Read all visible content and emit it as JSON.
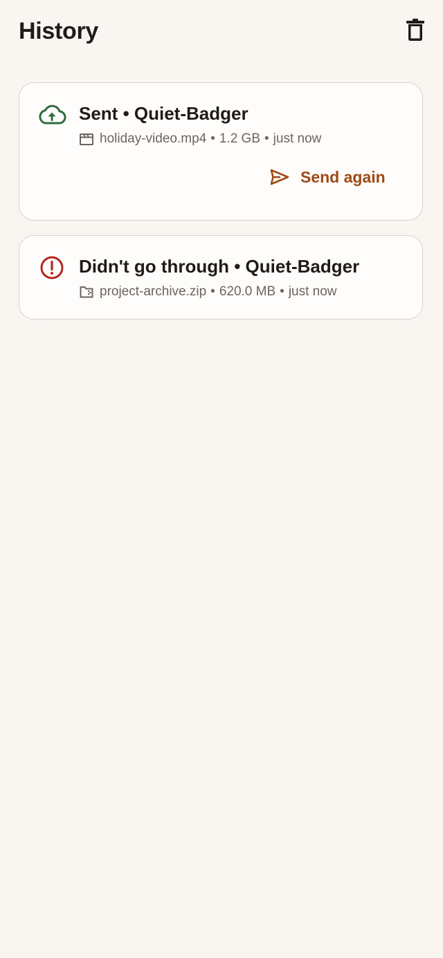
{
  "header": {
    "title": "History",
    "clear_icon": "trash-icon"
  },
  "colors": {
    "background": "#f9f5f1",
    "card_background": "#fffdfb",
    "card_border": "#d9d2c8",
    "success": "#2e6b3d",
    "error": "#b3261e",
    "accent": "#9e4a15",
    "text_primary": "#1e1b18",
    "text_secondary": "#6a645e"
  },
  "transfers": [
    {
      "status_icon": "cloud-upload-icon",
      "title": "Sent • Quiet-Badger",
      "file_icon": "video-file-icon",
      "file_name": "holiday-video.mp4",
      "separator_1": "•",
      "size": "1.2 GB",
      "separator_2": "•",
      "time": "just now",
      "action": {
        "icon": "send-icon",
        "label": "Send again"
      }
    },
    {
      "status_icon": "error-circle-icon",
      "title": "Didn't go through • Quiet-Badger",
      "file_icon": "archive-file-icon",
      "file_name": "project-archive.zip",
      "separator_1": "•",
      "size": "620.0 MB",
      "separator_2": "•",
      "time": "just now"
    }
  ]
}
